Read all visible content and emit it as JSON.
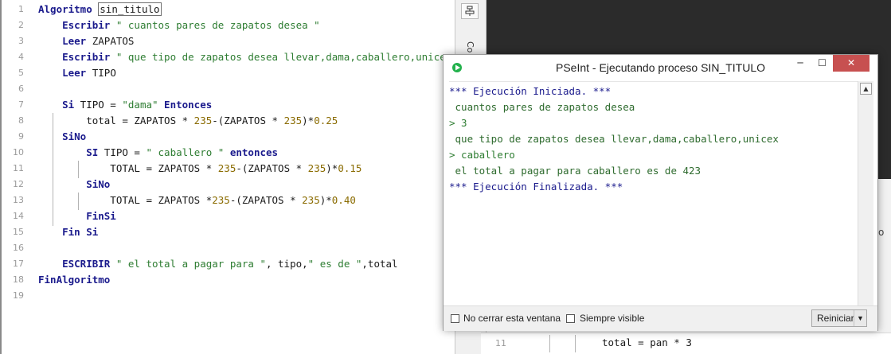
{
  "editor": {
    "lines": [
      {
        "n": "1",
        "tokens": [
          {
            "t": "Algoritmo",
            "c": "kw"
          },
          {
            "t": " ",
            "c": "id"
          },
          {
            "t": "sin_titulo",
            "c": "id boxed"
          }
        ]
      },
      {
        "n": "2",
        "tokens": [
          {
            "t": "    Escribir",
            "c": "kw"
          },
          {
            "t": " \" cuantos pares de zapatos desea \"",
            "c": "str"
          }
        ]
      },
      {
        "n": "3",
        "tokens": [
          {
            "t": "    Leer",
            "c": "kw"
          },
          {
            "t": " ZAPATOS",
            "c": "id"
          }
        ]
      },
      {
        "n": "4",
        "tokens": [
          {
            "t": "    Escribir",
            "c": "kw"
          },
          {
            "t": " \" que tipo de zapatos desea llevar,dama,caballero,unicex \"",
            "c": "str"
          }
        ]
      },
      {
        "n": "5",
        "tokens": [
          {
            "t": "    Leer",
            "c": "kw"
          },
          {
            "t": " TIPO",
            "c": "id"
          }
        ]
      },
      {
        "n": "6",
        "tokens": []
      },
      {
        "n": "7",
        "tokens": [
          {
            "t": "    Si",
            "c": "kw"
          },
          {
            "t": " TIPO = ",
            "c": "id"
          },
          {
            "t": "\"dama\"",
            "c": "str"
          },
          {
            "t": " Entonces",
            "c": "kw"
          }
        ]
      },
      {
        "n": "8",
        "tokens": [
          {
            "t": "        total = ZAPATOS * ",
            "c": "id"
          },
          {
            "t": "235",
            "c": "num"
          },
          {
            "t": "-(ZAPATOS * ",
            "c": "id"
          },
          {
            "t": "235",
            "c": "num"
          },
          {
            "t": ")*",
            "c": "id"
          },
          {
            "t": "0.25",
            "c": "num"
          }
        ]
      },
      {
        "n": "9",
        "tokens": [
          {
            "t": "    SiNo",
            "c": "kw"
          }
        ]
      },
      {
        "n": "10",
        "tokens": [
          {
            "t": "        SI",
            "c": "kw"
          },
          {
            "t": " TIPO = ",
            "c": "id"
          },
          {
            "t": "\" caballero \"",
            "c": "str"
          },
          {
            "t": " entonces",
            "c": "kw"
          }
        ]
      },
      {
        "n": "11",
        "tokens": [
          {
            "t": "            TOTAL = ZAPATOS * ",
            "c": "id"
          },
          {
            "t": "235",
            "c": "num"
          },
          {
            "t": "-(ZAPATOS * ",
            "c": "id"
          },
          {
            "t": "235",
            "c": "num"
          },
          {
            "t": ")*",
            "c": "id"
          },
          {
            "t": "0.15",
            "c": "num"
          }
        ]
      },
      {
        "n": "12",
        "tokens": [
          {
            "t": "        SiNo",
            "c": "kw"
          }
        ]
      },
      {
        "n": "13",
        "tokens": [
          {
            "t": "            TOTAL = ZAPATOS *",
            "c": "id"
          },
          {
            "t": "235",
            "c": "num"
          },
          {
            "t": "-(ZAPATOS * ",
            "c": "id"
          },
          {
            "t": "235",
            "c": "num"
          },
          {
            "t": ")*",
            "c": "id"
          },
          {
            "t": "0.40",
            "c": "num"
          }
        ]
      },
      {
        "n": "14",
        "tokens": [
          {
            "t": "        FinSi",
            "c": "kw"
          }
        ]
      },
      {
        "n": "15",
        "tokens": [
          {
            "t": "    Fin Si",
            "c": "kw"
          }
        ]
      },
      {
        "n": "16",
        "tokens": []
      },
      {
        "n": "17",
        "tokens": [
          {
            "t": "    ESCRIBIR",
            "c": "kw"
          },
          {
            "t": " \" el total a pagar para \"",
            "c": "str"
          },
          {
            "t": ", tipo,",
            "c": "id"
          },
          {
            "t": "\" es de \"",
            "c": "str"
          },
          {
            "t": ",total",
            "c": "id"
          }
        ]
      },
      {
        "n": "18",
        "tokens": [
          {
            "t": "FinAlgoritmo",
            "c": "kw"
          }
        ]
      },
      {
        "n": "19",
        "tokens": []
      }
    ]
  },
  "side_strip": {
    "vertical_label": "Co",
    "button_icon": "flow-icon"
  },
  "right_peek": {
    "text": "o"
  },
  "bottom_editor": {
    "line_number": "11",
    "code": "total = pan * 3"
  },
  "exec_window": {
    "title": "PSeInt - Ejecutando proceso SIN_TITULO",
    "app_icon": "pseint-icon",
    "controls": {
      "minimize": "─",
      "maximize": "☐",
      "close": "✕"
    },
    "console": [
      {
        "text": "*** Ejecución Iniciada. ***",
        "kind": "sys"
      },
      {
        "text": " cuantos pares de zapatos desea",
        "kind": "out"
      },
      {
        "text": "> 3",
        "kind": "in"
      },
      {
        "text": " que tipo de zapatos desea llevar,dama,caballero,unicex",
        "kind": "out"
      },
      {
        "text": "> caballero",
        "kind": "in"
      },
      {
        "text": " el total a pagar para caballero es de 423",
        "kind": "out"
      },
      {
        "text": "*** Ejecución Finalizada. ***",
        "kind": "sys"
      }
    ],
    "checkboxes": [
      {
        "label": "No cerrar esta ventana",
        "checked": false
      },
      {
        "label": "Siempre visible",
        "checked": false
      }
    ],
    "restart_button": "Reiniciar",
    "colors": {
      "close_button": "#c75050",
      "keyword": "#1a1a8c",
      "string": "#2e7d32",
      "number": "#8a6b00"
    }
  }
}
